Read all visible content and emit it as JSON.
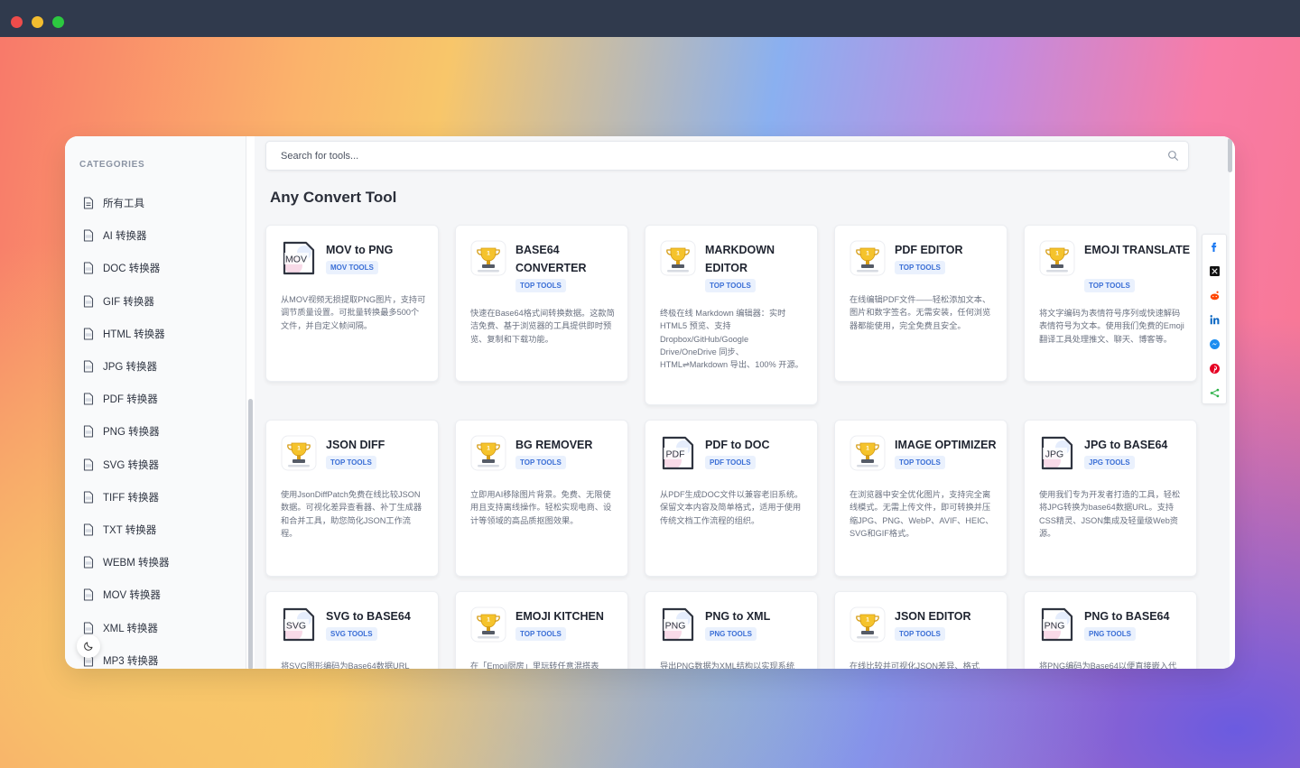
{
  "sidebar": {
    "title": "CATEGORIES",
    "items": [
      {
        "label": "所有工具",
        "icon": "document-icon"
      },
      {
        "label": "AI 转换器",
        "icon": "ai-file-icon"
      },
      {
        "label": "DOC 转换器",
        "icon": "doc-file-icon"
      },
      {
        "label": "GIF 转换器",
        "icon": "gif-file-icon"
      },
      {
        "label": "HTML 转换器",
        "icon": "html-file-icon"
      },
      {
        "label": "JPG 转换器",
        "icon": "jpg-file-icon"
      },
      {
        "label": "PDF 转换器",
        "icon": "pdf-file-icon"
      },
      {
        "label": "PNG 转换器",
        "icon": "png-file-icon"
      },
      {
        "label": "SVG 转换器",
        "icon": "svg-file-icon"
      },
      {
        "label": "TIFF 转换器",
        "icon": "tiff-file-icon"
      },
      {
        "label": "TXT 转换器",
        "icon": "txt-file-icon"
      },
      {
        "label": "WEBM 转换器",
        "icon": "webm-file-icon"
      },
      {
        "label": "MOV 转换器",
        "icon": "mov-file-icon"
      },
      {
        "label": "XML 转换器",
        "icon": "xml-file-icon"
      },
      {
        "label": "MP3 转换器",
        "icon": "mp3-file-icon"
      }
    ]
  },
  "search": {
    "placeholder": "Search for tools..."
  },
  "page_title": "Any Convert Tool",
  "cards": [
    {
      "title": "MOV to PNG",
      "tag": "MOV TOOLS",
      "icon": "MOV",
      "desc": "从MOV视频无损提取PNG图片，支持可调节质量设置。可批量转换最多500个文件，并自定义帧间隔。"
    },
    {
      "title": "BASE64 CONVERTER",
      "tag": "TOP TOOLS",
      "icon": "trophy",
      "desc": "快速在Base64格式间转换数据。这款简洁免费、基于浏览器的工具提供即时预览、复制和下载功能。"
    },
    {
      "title": "MARKDOWN EDITOR",
      "tag": "TOP TOOLS",
      "icon": "trophy",
      "desc": "终极在线 Markdown 编辑器：实时 HTML5 预览、支持 Dropbox/GitHub/Google Drive/OneDrive 同步、HTML⇌Markdown 导出、100% 开源。"
    },
    {
      "title": "PDF EDITOR",
      "tag": "TOP TOOLS",
      "icon": "trophy",
      "desc": "在线编辑PDF文件——轻松添加文本、图片和数字签名。无需安装，任何浏览器都能使用，完全免费且安全。"
    },
    {
      "title": "EMOJI TRANSLATE",
      "tag": "TOP TOOLS",
      "icon": "trophy",
      "desc": "将文字编码为表情符号序列或快速解码表情符号为文本。使用我们免费的Emoji翻译工具处理推文、聊天、博客等。"
    },
    {
      "title": "JSON DIFF",
      "tag": "TOP TOOLS",
      "icon": "trophy",
      "desc": "使用JsonDiffPatch免费在线比较JSON数据。可视化差异查看器、补丁生成器和合并工具，助您简化JSON工作流程。"
    },
    {
      "title": "BG REMOVER",
      "tag": "TOP TOOLS",
      "icon": "trophy",
      "desc": "立即用AI移除图片背景。免费、无限使用且支持离线操作。轻松实现电商、设计等领域的高品质抠图效果。"
    },
    {
      "title": "PDF to DOC",
      "tag": "PDF TOOLS",
      "icon": "PDF",
      "desc": "从PDF生成DOC文件以兼容老旧系统。保留文本内容及简单格式，适用于使用传统文档工作流程的组织。"
    },
    {
      "title": "IMAGE OPTIMIZER",
      "tag": "TOP TOOLS",
      "icon": "trophy",
      "desc": "在浏览器中安全优化图片，支持完全离线模式。无需上传文件，即可转换并压缩JPG、PNG、WebP、AVIF、HEIC、SVG和GIF格式。"
    },
    {
      "title": "JPG to BASE64",
      "tag": "JPG TOOLS",
      "icon": "JPG",
      "desc": "使用我们专为开发者打造的工具，轻松将JPG转换为base64数据URL。支持CSS精灵、JSON集成及轻量级Web资源。"
    },
    {
      "title": "SVG to BASE64",
      "tag": "SVG TOOLS",
      "icon": "SVG",
      "desc": "将SVG图形编码为Base64数据URL"
    },
    {
      "title": "EMOJI KITCHEN",
      "tag": "TOP TOOLS",
      "icon": "trophy",
      "desc": "在「Emoji厨房」里玩转任意混搭表"
    },
    {
      "title": "PNG to XML",
      "tag": "PNG TOOLS",
      "icon": "PNG",
      "desc": "导出PNG数据为XML结构以实现系统"
    },
    {
      "title": "JSON EDITOR",
      "tag": "TOP TOOLS",
      "icon": "trophy",
      "desc": "在线比较并可视化JSON差异、格式"
    },
    {
      "title": "PNG to BASE64",
      "tag": "PNG TOOLS",
      "icon": "PNG",
      "desc": "将PNG编码为Base64以便直接嵌入代"
    }
  ],
  "share": [
    "facebook-icon",
    "x-twitter-icon",
    "reddit-icon",
    "linkedin-icon",
    "messenger-icon",
    "pinterest-icon",
    "share-icon"
  ],
  "colors": {
    "accent": "#3b6fd6",
    "tag_bg": "#eaf1fd",
    "titlebar": "#303a4d"
  }
}
